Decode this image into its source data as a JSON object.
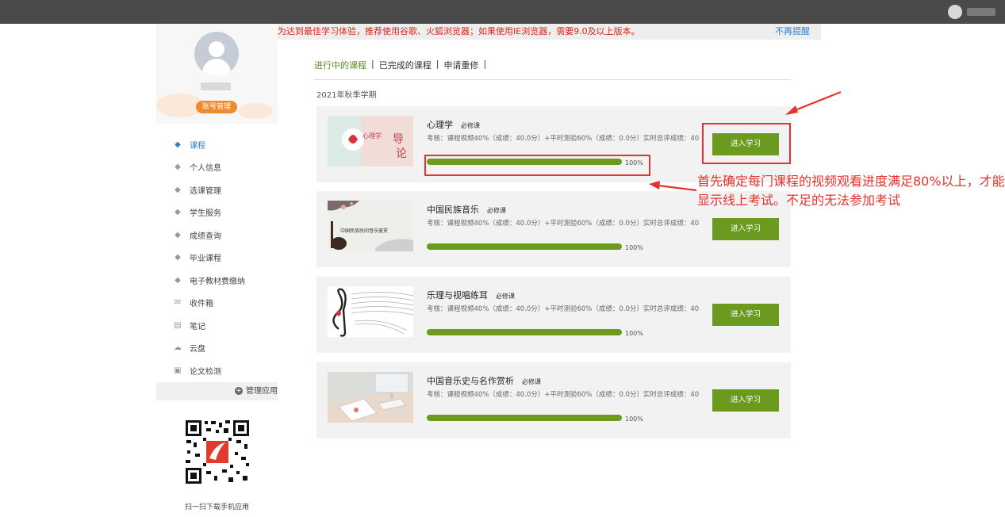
{
  "notice": {
    "message": "为达到最佳学习体验，推荐使用谷歌、火狐浏览器；如果使用IE浏览器，需要9.0及以上版本。",
    "dismiss": "不再提醒"
  },
  "profile": {
    "account_button": "账号管理"
  },
  "sidebar": {
    "items": [
      {
        "label": "课程",
        "icon": "graduation-cap-icon",
        "active": true
      },
      {
        "label": "个人信息",
        "icon": "graduation-cap-icon"
      },
      {
        "label": "选课管理",
        "icon": "graduation-cap-icon"
      },
      {
        "label": "学生服务",
        "icon": "graduation-cap-icon"
      },
      {
        "label": "成绩查询",
        "icon": "graduation-cap-icon"
      },
      {
        "label": "毕业课程",
        "icon": "graduation-cap-icon"
      },
      {
        "label": "电子教材费缴纳",
        "icon": "graduation-cap-icon"
      },
      {
        "label": "收件箱",
        "icon": "inbox-icon"
      },
      {
        "label": "笔记",
        "icon": "note-icon"
      },
      {
        "label": "云盘",
        "icon": "cloud-icon"
      },
      {
        "label": "论文检测",
        "icon": "document-check-icon"
      }
    ],
    "manage_apps": "管理应用",
    "qr_caption": "扫一扫下载手机应用"
  },
  "tabs": [
    "进行中的课程",
    "已完成的课程",
    "申请重修"
  ],
  "term": "2021年秋季学期",
  "courses": [
    {
      "title": "心理学",
      "required": "必修课",
      "exam": "考核：课程视频40%（成绩：40.0分）+平时测验60%（成绩：0.0分）实时总评成绩：40",
      "progress": 1.0,
      "progress_label": "100%",
      "button": "进入学习"
    },
    {
      "title": "中国民族音乐",
      "required": "必修课",
      "exam": "考核：课程视频40%（成绩：40.0分）+平时测验60%（成绩：0.0分）实时总评成绩：40",
      "progress": 1.0,
      "progress_label": "100%",
      "button": "进入学习"
    },
    {
      "title": "乐理与视唱练耳",
      "required": "必修课",
      "exam": "考核：课程视频40%（成绩：40.0分）+平时测验60%（成绩：0.0分）实时总评成绩：40",
      "progress": 1.0,
      "progress_label": "100%",
      "button": "进入学习"
    },
    {
      "title": "中国音乐史与名作赏析",
      "required": "必修课",
      "exam": "考核：课程视频40%（成绩：40.0分）+平时测验60%（成绩：0.0分）实时总评成绩：40",
      "progress": 1.0,
      "progress_label": "100%",
      "button": "进入学习"
    }
  ],
  "thumbs": [
    {
      "text_a": "心理学",
      "text_b": "导",
      "text_c": "论"
    },
    {
      "text_a": "中国民族民间音乐鉴赏"
    }
  ],
  "annotation": "首先确定每门课程的视频观看进度满足80%以上，才能显示线上考试。不足的无法参加考试",
  "colors": {
    "accent_green": "#6b9a1f",
    "annotation_red": "#e5322d",
    "link_blue": "#2a7fd6",
    "orange": "#f08a2e"
  }
}
